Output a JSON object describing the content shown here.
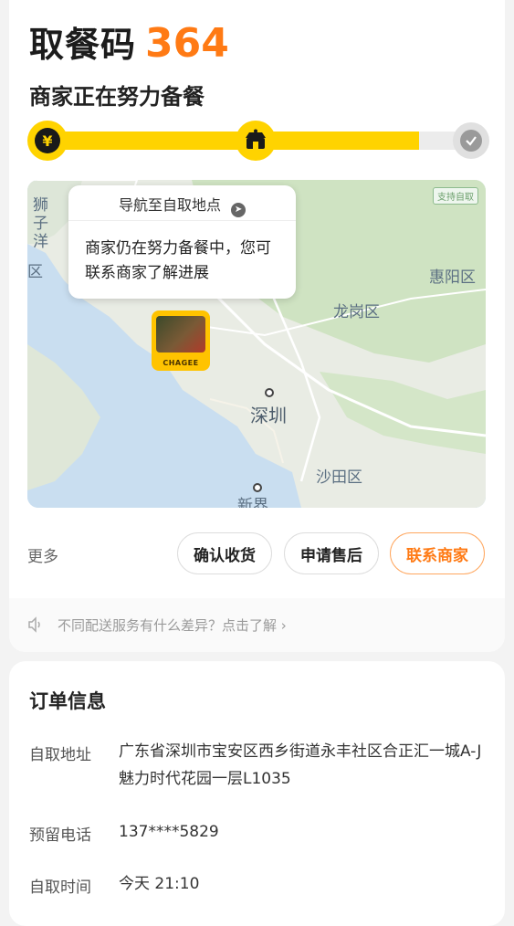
{
  "header": {
    "pickup_label": "取餐码",
    "pickup_code": "364",
    "status": "商家正在努力备餐"
  },
  "progress": {
    "fill_fraction": 0.87,
    "icons": [
      "yen-icon",
      "shop-icon",
      "check-icon"
    ]
  },
  "map": {
    "tag": "支持自取",
    "labels": {
      "shizi": "狮子洋",
      "district_left": "区",
      "huiyang": "惠阳区",
      "longgang": "龙岗区",
      "shenzhen": "深圳",
      "shatian": "沙田区",
      "xinjie": "新界"
    },
    "bubble": {
      "nav": "导航至自取地点",
      "message": "商家仍在努力备餐中，您可联系商家了解进展"
    },
    "store_brand": "CHAGEE"
  },
  "actions": {
    "more": "更多",
    "confirm": "确认收货",
    "after_sale": "申请售后",
    "contact": "联系商家"
  },
  "notice": {
    "text": "不同配送服务有什么差异？点击了解 ›"
  },
  "order": {
    "title": "订单信息",
    "address_label": "自取地址",
    "address_value": "广东省深圳市宝安区西乡街道永丰社区合正汇一城A-J魅力时代花园一层L1035",
    "phone_label": "预留电话",
    "phone_value": "137****5829",
    "time_label": "自取时间",
    "time_value": "今天 21:10"
  },
  "colors": {
    "accent": "#ff7a14",
    "progress": "#ffd300"
  }
}
